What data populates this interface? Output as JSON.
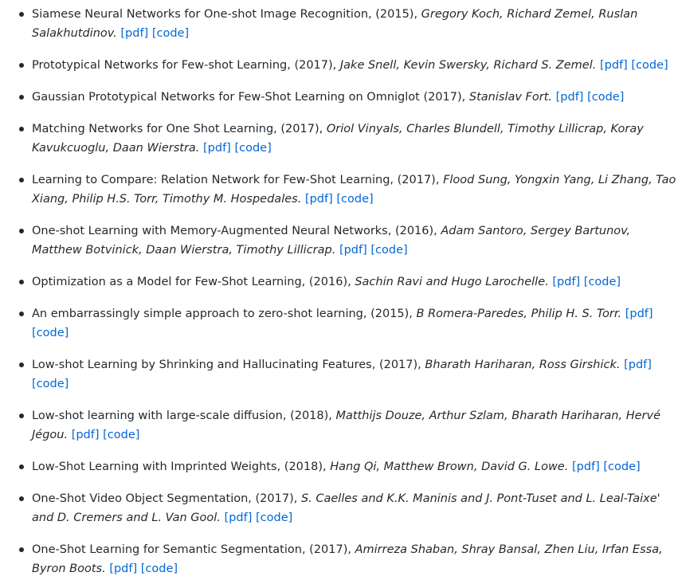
{
  "papers": [
    {
      "title": "Siamese Neural Networks for One-shot Image Recognition",
      "sep": ", ",
      "year": "(2015), ",
      "authors": "Gregory Koch, Richard Zemel, Ruslan Salakhutdinov.",
      "pdf": "[pdf]",
      "code": "[code]"
    },
    {
      "title": "Prototypical Networks for Few-shot Learning",
      "sep": ", ",
      "year": "(2017), ",
      "authors": "Jake Snell, Kevin Swersky, Richard S. Zemel.",
      "pdf": "[pdf]",
      "code": "[code]"
    },
    {
      "title": "Gaussian Prototypical Networks for Few-Shot Learning on Omniglot",
      "sep": " ",
      "year": "(2017), ",
      "authors": "Stanislav Fort.",
      "pdf": "[pdf]",
      "code": "[code]"
    },
    {
      "title": "Matching Networks for One Shot Learning",
      "sep": ", ",
      "year": "(2017), ",
      "authors": "Oriol Vinyals, Charles Blundell, Timothy Lillicrap, Koray Kavukcuoglu, Daan Wierstra.",
      "pdf": "[pdf]",
      "code": "[code]"
    },
    {
      "title": "Learning to Compare: Relation Network for Few-Shot Learning",
      "sep": ", ",
      "year": "(2017), ",
      "authors": "Flood Sung, Yongxin Yang, Li Zhang, Tao Xiang, Philip H.S. Torr, Timothy M. Hospedales.",
      "pdf": "[pdf]",
      "code": "[code]"
    },
    {
      "title": "One-shot Learning with Memory-Augmented Neural Networks",
      "sep": ", ",
      "year": "(2016), ",
      "authors": "Adam Santoro, Sergey Bartunov, Matthew Botvinick, Daan Wierstra, Timothy Lillicrap.",
      "pdf": "[pdf]",
      "code": "[code]"
    },
    {
      "title": "Optimization as a Model for Few-Shot Learning",
      "sep": ", ",
      "year": "(2016), ",
      "authors": "Sachin Ravi and Hugo Larochelle.",
      "pdf": "[pdf]",
      "code": "[code]"
    },
    {
      "title": "An embarrassingly simple approach to zero-shot learning",
      "sep": ", ",
      "year": "(2015), ",
      "authors": "B Romera-Paredes, Philip H. S. Torr.",
      "pdf": "[pdf]",
      "code": "[code]"
    },
    {
      "title": "Low-shot Learning by Shrinking and Hallucinating Features",
      "sep": ", ",
      "year": "(2017), ",
      "authors": "Bharath Hariharan, Ross Girshick.",
      "pdf": "[pdf]",
      "code": "[code]"
    },
    {
      "title": "Low-shot learning with large-scale diffusion",
      "sep": ", ",
      "year": "(2018), ",
      "authors": "Matthijs Douze, Arthur Szlam, Bharath Hariharan, Hervé Jégou.",
      "pdf": "[pdf]",
      "code": "[code]"
    },
    {
      "title": "Low-Shot Learning with Imprinted Weights",
      "sep": ", ",
      "year": "(2018), ",
      "authors": "Hang Qi, Matthew Brown, David G. Lowe.",
      "pdf": "[pdf]",
      "code": "[code]"
    },
    {
      "title": "One-Shot Video Object Segmentation",
      "sep": ", ",
      "year": "(2017), ",
      "authors": "S. Caelles and K.K. Maninis and J. Pont-Tuset and L. Leal-Taixe' and D. Cremers and L. Van Gool.",
      "pdf": "[pdf]",
      "code": "[code]"
    },
    {
      "title": "One-Shot Learning for Semantic Segmentation",
      "sep": ", ",
      "year": "(2017), ",
      "authors": "Amirreza Shaban, Shray Bansal, Zhen Liu, Irfan Essa, Byron Boots.",
      "pdf": "[pdf]",
      "code": "[code]"
    }
  ],
  "colors": {
    "text": "#24292e",
    "link": "#0366d6"
  }
}
